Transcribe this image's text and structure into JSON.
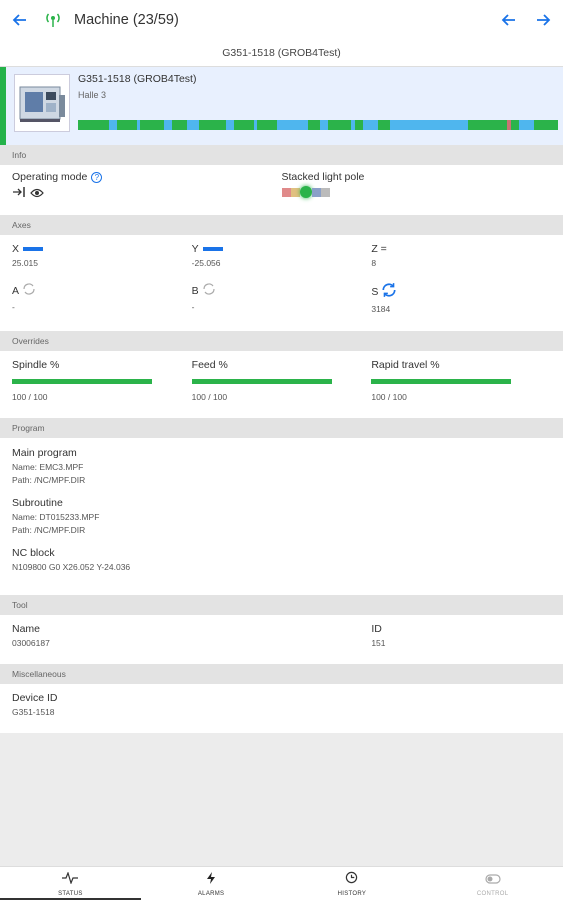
{
  "header": {
    "title": "Machine (23/59)",
    "subtitle": "G351-1518 (GROB4Test)"
  },
  "machine": {
    "name": "G351-1518 (GROB4Test)",
    "hall": "Halle 3",
    "status_color": "#24b24a",
    "timeline": [
      {
        "color": "#2bb34a",
        "w": 8
      },
      {
        "color": "#4fb6ee",
        "w": 2
      },
      {
        "color": "#2bb34a",
        "w": 5
      },
      {
        "color": "#4fb6ee",
        "w": 1
      },
      {
        "color": "#2bb34a",
        "w": 6
      },
      {
        "color": "#4fb6ee",
        "w": 2
      },
      {
        "color": "#2bb34a",
        "w": 4
      },
      {
        "color": "#4fb6ee",
        "w": 3
      },
      {
        "color": "#2bb34a",
        "w": 7
      },
      {
        "color": "#4fb6ee",
        "w": 2
      },
      {
        "color": "#2bb34a",
        "w": 5
      },
      {
        "color": "#4fb6ee",
        "w": 1
      },
      {
        "color": "#2bb34a",
        "w": 5
      },
      {
        "color": "#4fb6ee",
        "w": 8
      },
      {
        "color": "#2bb34a",
        "w": 3
      },
      {
        "color": "#4fb6ee",
        "w": 2
      },
      {
        "color": "#2bb34a",
        "w": 6
      },
      {
        "color": "#4fb6ee",
        "w": 1
      },
      {
        "color": "#2bb34a",
        "w": 2
      },
      {
        "color": "#4fb6ee",
        "w": 4
      },
      {
        "color": "#2bb34a",
        "w": 3
      },
      {
        "color": "#4fb6ee",
        "w": 20
      },
      {
        "color": "#2bb34a",
        "w": 10
      },
      {
        "color": "#c97474",
        "w": 1
      },
      {
        "color": "#2bb34a",
        "w": 2
      },
      {
        "color": "#4fb6ee",
        "w": 4
      },
      {
        "color": "#2bb34a",
        "w": 6
      }
    ]
  },
  "info": {
    "section": "Info",
    "operating_mode_label": "Operating mode",
    "help_icon": "?",
    "light_pole_label": "Stacked light pole"
  },
  "axes": {
    "section": "Axes",
    "x": {
      "name": "X",
      "value": "25.015"
    },
    "y": {
      "name": "Y",
      "value": "-25.056"
    },
    "z": {
      "name": "Z =",
      "value": "8"
    },
    "a": {
      "name": "A",
      "value": "-"
    },
    "b": {
      "name": "B",
      "value": "-"
    },
    "s": {
      "name": "S",
      "value": "3184"
    }
  },
  "overrides": {
    "section": "Overrides",
    "spindle": {
      "label": "Spindle %",
      "value": "100 / 100",
      "fraction": 1.0
    },
    "feed": {
      "label": "Feed %",
      "value": "100 / 100",
      "fraction": 1.0
    },
    "rapid": {
      "label": "Rapid travel %",
      "value": "100 / 100",
      "fraction": 1.0
    }
  },
  "program": {
    "section": "Program",
    "main": {
      "title": "Main program",
      "name": "Name: EMC3.MPF",
      "path": "Path: /NC/MPF.DIR"
    },
    "sub": {
      "title": "Subroutine",
      "name": "Name: DT015233.MPF",
      "path": "Path: /NC/MPF.DIR"
    },
    "nc": {
      "title": "NC block",
      "value": "N109800 G0 X26.052 Y-24.036"
    }
  },
  "tool": {
    "section": "Tool",
    "name_label": "Name",
    "name_value": "03006187",
    "id_label": "ID",
    "id_value": "151"
  },
  "misc": {
    "section": "Miscellaneous",
    "device_label": "Device ID",
    "device_value": "G351-1518"
  },
  "nav": {
    "status": "STATUS",
    "alarms": "ALARMS",
    "history": "HISTORY",
    "control": "CONTROL"
  },
  "colors": {
    "accent": "#1a73e8",
    "ok": "#2bb34a",
    "section_bg": "#e3e3e3"
  }
}
